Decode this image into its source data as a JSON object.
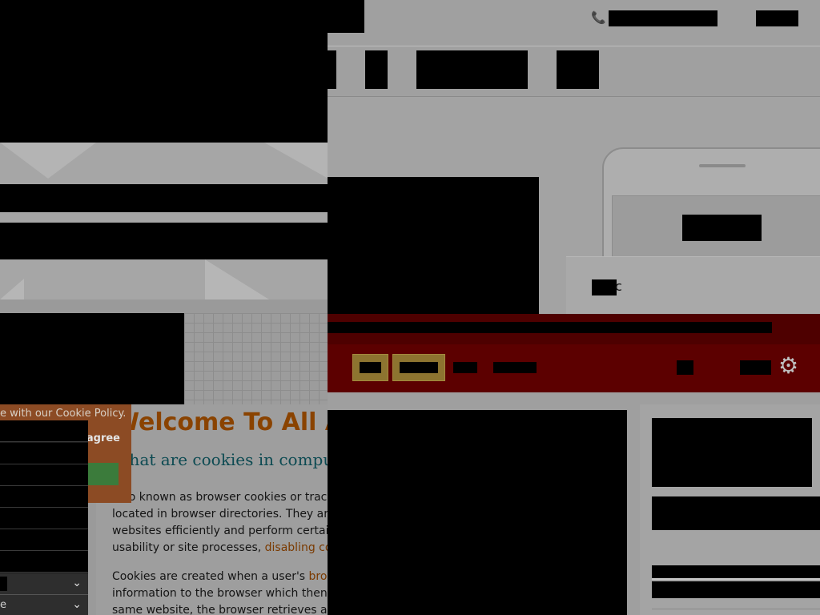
{
  "header": {
    "phone_icon": "phone-icon",
    "brand_color": "#5c0000",
    "accent_color": "#8d7430"
  },
  "hero": {
    "card_letter": "c"
  },
  "toolbar": {
    "gear_icon": "gear-icon",
    "gear_glyph": "⚙"
  },
  "cookie_popup": {
    "notice_text": "e with our Cookie Policy.",
    "disagree_label": "I disagree"
  },
  "content": {
    "title": "Welcome To All A",
    "subtitle": "What are cookies in compu",
    "paragraph1": [
      {
        "text": "Also known as browser cookies or trac"
      },
      {
        "text": "located in browser directories. They are"
      },
      {
        "text": "websites efficiently and perform certair"
      },
      {
        "text": "usability or site processes, ",
        "link": "disabling co"
      }
    ],
    "paragraph2": [
      {
        "text": "Cookies are created when a user's ",
        "link": "brov"
      },
      {
        "text": "information to the browser which then"
      },
      {
        "text": "same website, the browser retrieves an"
      }
    ]
  },
  "left_list": {
    "select_rows": [
      {
        "text": "",
        "icon": "chevron-down-icon"
      },
      {
        "text": "e",
        "icon": "chevron-down-icon"
      }
    ]
  }
}
